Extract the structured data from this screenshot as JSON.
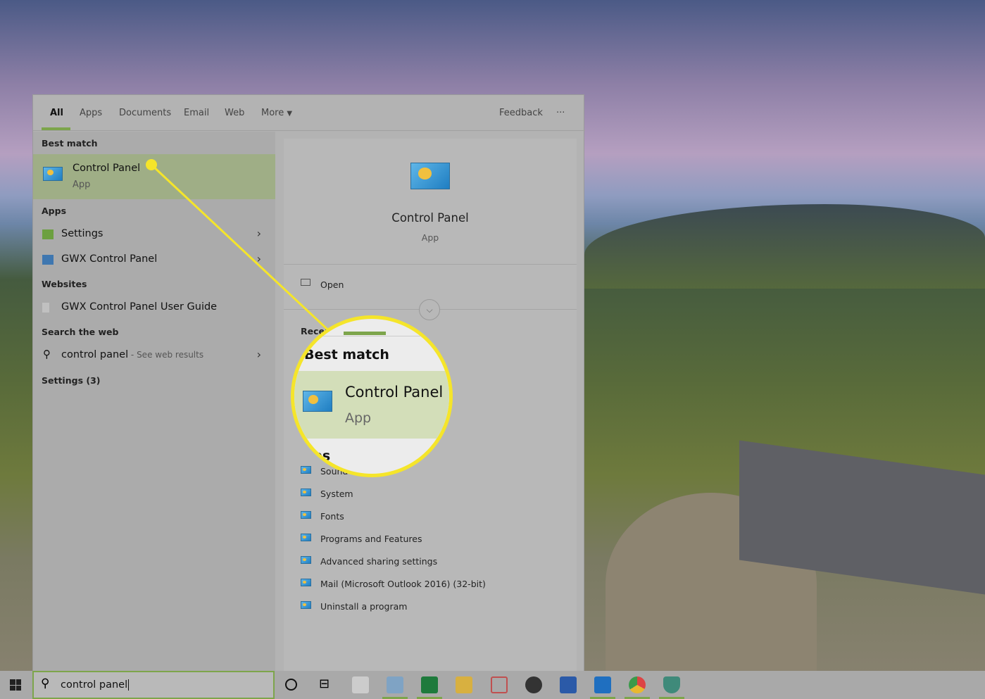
{
  "tabs": {
    "all": "All",
    "apps": "Apps",
    "documents": "Documents",
    "email": "Email",
    "web": "Web",
    "more": "More",
    "feedback": "Feedback",
    "options": "···"
  },
  "left": {
    "best_match_header": "Best match",
    "best_match": {
      "title": "Control Panel",
      "subtitle": "App"
    },
    "apps_header": "Apps",
    "apps": [
      "Settings",
      "GWX Control Panel"
    ],
    "websites_header": "Websites",
    "website": "GWX Control Panel User Guide",
    "search_web_header": "Search the web",
    "web_query": "control panel",
    "web_suffix": " - See web results",
    "settings_header": "Settings (3)"
  },
  "right": {
    "title": "Control Panel",
    "subtitle": "App",
    "open": "Open",
    "recent_header": "Recent",
    "recent": [
      "Sound",
      "System",
      "Fonts",
      "Programs and Features",
      "Advanced sharing settings",
      "Mail (Microsoft Outlook 2016) (32-bit)",
      "Uninstall a program"
    ]
  },
  "magnifier": {
    "header": "Best match",
    "title": "Control Panel",
    "subtitle": "App",
    "next_header": "Apps"
  },
  "search": {
    "value": "control panel"
  },
  "colors": {
    "accent": "#7da54b",
    "callout": "#f5e52a"
  }
}
